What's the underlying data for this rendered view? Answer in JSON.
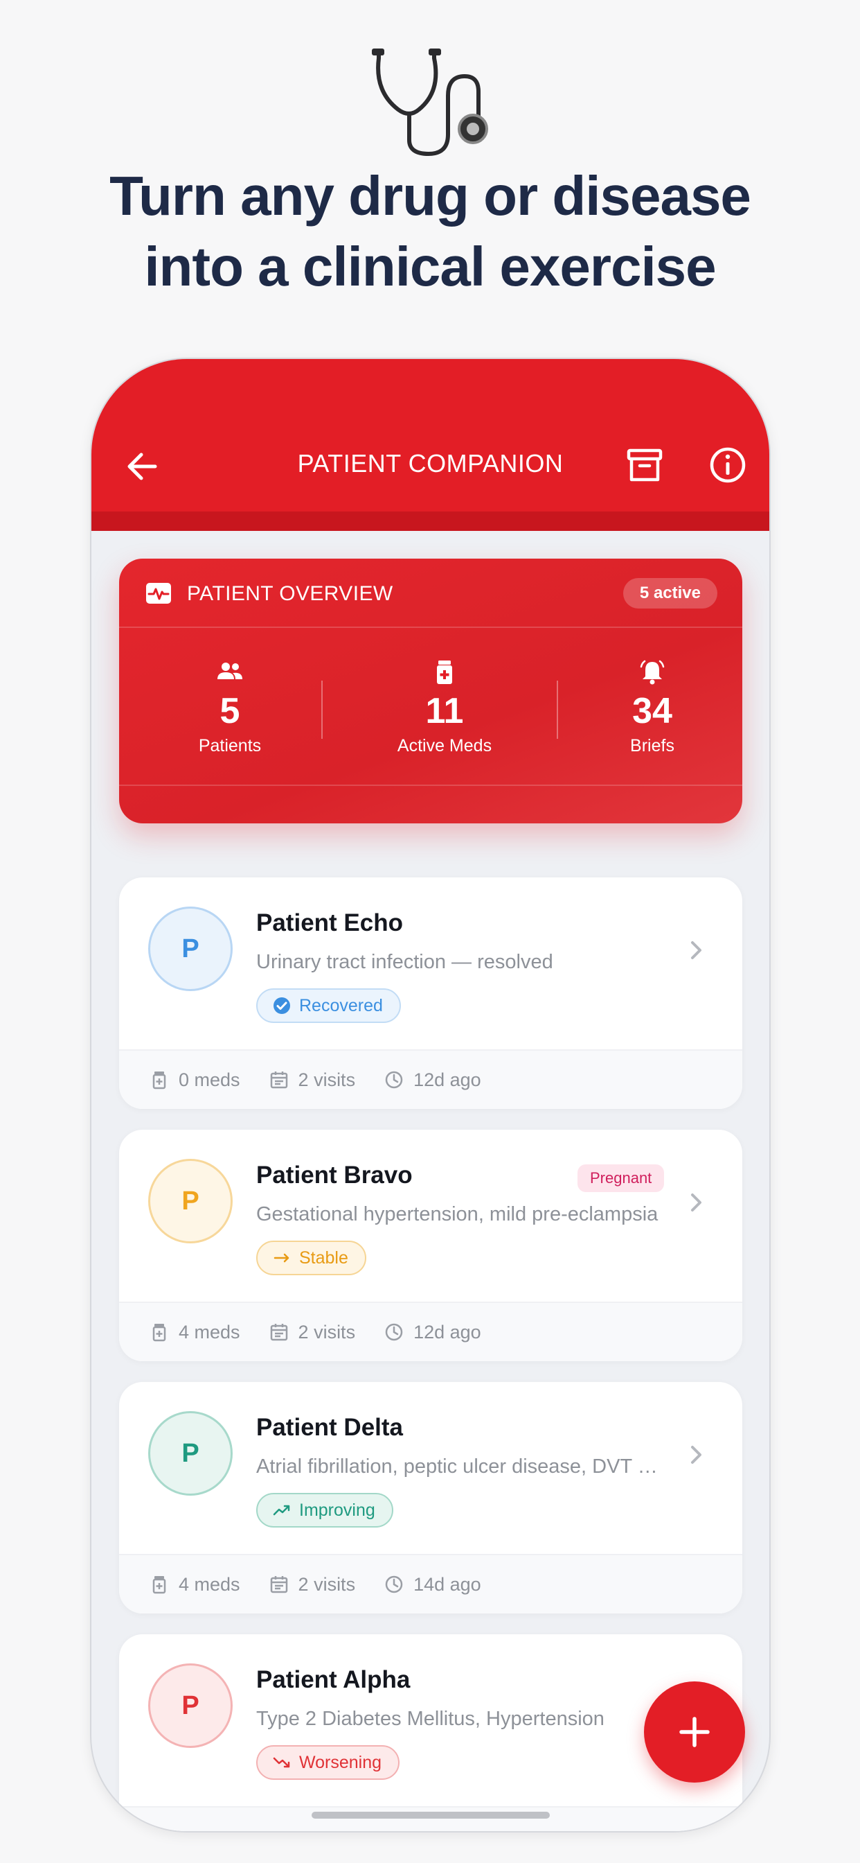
{
  "hero": {
    "headline_line1": "Turn any drug or disease",
    "headline_line2": "into a clinical exercise",
    "icon": "stethoscope-icon"
  },
  "appbar": {
    "title": "PATIENT COMPANION",
    "icons": [
      "arrow-left-icon",
      "archive-icon",
      "info-icon"
    ],
    "color": "#e31e26"
  },
  "overview": {
    "title": "PATIENT OVERVIEW",
    "badge": "5 active",
    "stats": [
      {
        "value": "5",
        "label": "Patients",
        "icon": "people-icon"
      },
      {
        "value": "11",
        "label": "Active Meds",
        "icon": "pill-bottle-icon"
      },
      {
        "value": "34",
        "label": "Briefs",
        "icon": "bell-icon"
      }
    ]
  },
  "patients": [
    {
      "initial": "P",
      "name": "Patient Echo",
      "diagnosis": "Urinary tract infection — resolved",
      "status": "Recovered",
      "status_color": "#3b8fe0",
      "tag": "",
      "meds": "0 meds",
      "visits": "2 visits",
      "last": "12d ago"
    },
    {
      "initial": "P",
      "name": "Patient Bravo",
      "diagnosis": "Gestational hypertension, mild pre-eclampsia",
      "status": "Stable",
      "status_color": "#f0a51f",
      "tag": "Pregnant",
      "meds": "4 meds",
      "visits": "2 visits",
      "last": "12d ago"
    },
    {
      "initial": "P",
      "name": "Patient Delta",
      "diagnosis": "Atrial fibrillation, peptic ulcer disease, DVT history",
      "status": "Improving",
      "status_color": "#1f9a80",
      "tag": "",
      "meds": "4 meds",
      "visits": "2 visits",
      "last": "14d ago"
    },
    {
      "initial": "P",
      "name": "Patient Alpha",
      "diagnosis": "Type 2 Diabetes Mellitus, Hypertension",
      "status": "Worsening",
      "status_color": "#e03236",
      "tag": "",
      "meds": "",
      "visits": "",
      "last": ""
    }
  ],
  "fab": {
    "icon": "plus-icon"
  }
}
